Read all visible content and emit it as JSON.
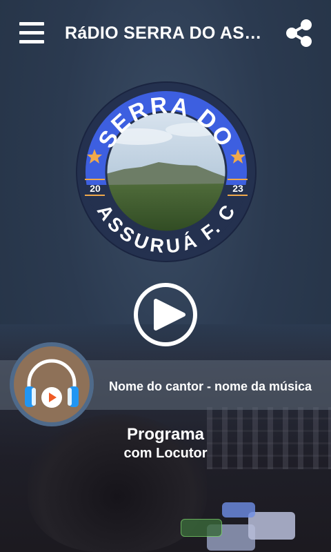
{
  "header": {
    "title": "RáDIO SERRA DO ASSURUÁ F.C",
    "menu_icon": "hamburger-menu-icon",
    "share_icon": "share-icon"
  },
  "logo": {
    "top_text": "SERRA DO",
    "bottom_text": "ASSURUÁ F. C",
    "year_left": "20",
    "year_right": "23"
  },
  "player": {
    "play_icon": "play-icon",
    "now_playing": "Nome do cantor - nome da música",
    "program_title": "Programa",
    "program_host": "com Locutor"
  },
  "colors": {
    "background": "#2b3a50",
    "logo_ring": "#24314f",
    "logo_blue": "#3d5fe0",
    "star": "#f1a94b",
    "avatar_bg": "#8e7158",
    "headphone_blue": "#2196f3",
    "play_orange": "#ef5b25"
  }
}
